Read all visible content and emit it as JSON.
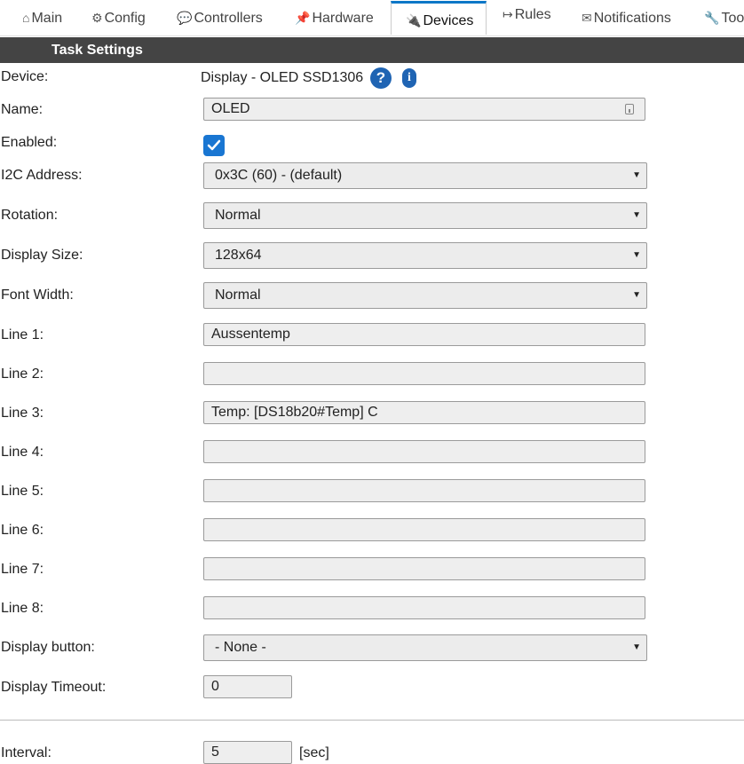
{
  "nav": {
    "tabs": [
      {
        "icon": "⌂",
        "label": "Main"
      },
      {
        "icon": "⚙",
        "label": "Config"
      },
      {
        "icon": "💬",
        "label": "Controllers"
      },
      {
        "icon": "📌",
        "label": "Hardware"
      },
      {
        "icon": "🔌",
        "label": "Devices"
      },
      {
        "icon": "↦",
        "label": "Rules"
      },
      {
        "icon": "✉",
        "label": "Notifications"
      },
      {
        "icon": "🔧",
        "label": "Tools"
      }
    ],
    "active": "Devices"
  },
  "section": {
    "title": "Task Settings"
  },
  "form": {
    "device": {
      "label": "Device:",
      "value": "Display - OLED SSD1306",
      "help": "?",
      "info": "i"
    },
    "name": {
      "label": "Name:",
      "value": "OLED"
    },
    "enabled": {
      "label": "Enabled:",
      "checked": true
    },
    "i2c_address": {
      "label": "I2C Address:",
      "value": "0x3C (60) - (default)"
    },
    "rotation": {
      "label": "Rotation:",
      "value": "Normal"
    },
    "display_size": {
      "label": "Display Size:",
      "value": "128x64"
    },
    "font_width": {
      "label": "Font Width:",
      "value": "Normal"
    },
    "lines": [
      {
        "label": "Line 1:",
        "value": "Aussentemp"
      },
      {
        "label": "Line 2:",
        "value": ""
      },
      {
        "label": "Line 3:",
        "value": "Temp: [DS18b20#Temp] C"
      },
      {
        "label": "Line 4:",
        "value": ""
      },
      {
        "label": "Line 5:",
        "value": ""
      },
      {
        "label": "Line 6:",
        "value": ""
      },
      {
        "label": "Line 7:",
        "value": ""
      },
      {
        "label": "Line 8:",
        "value": ""
      }
    ],
    "display_button": {
      "label": "Display button:",
      "value": "- None -"
    },
    "display_timeout": {
      "label": "Display Timeout:",
      "value": "0"
    },
    "interval": {
      "label": "Interval:",
      "value": "5",
      "unit": "[sec]"
    }
  },
  "colors": {
    "accent": "#1976d2",
    "header_bg": "#444444",
    "active_tab": "#0b77c7"
  }
}
